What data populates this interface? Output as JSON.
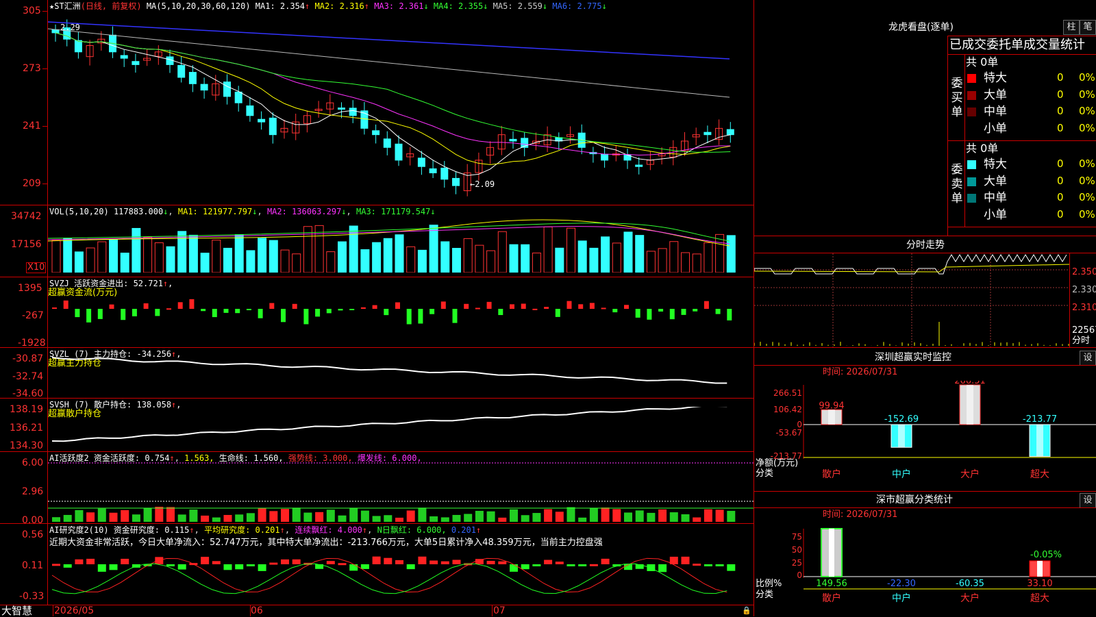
{
  "stock": {
    "name": "★ST汇洲",
    "mode": "(日线, 前复权)",
    "ma_params": "MA(5,10,20,30,60,120)",
    "ma": [
      {
        "label": "MA1:",
        "value": "2.354",
        "arrow": "↑",
        "color": "#ffffff"
      },
      {
        "label": "MA2:",
        "value": "2.316",
        "arrow": "↑",
        "color": "#ffff00"
      },
      {
        "label": "MA3:",
        "value": "2.361",
        "arrow": "↓",
        "color": "#ff33ff"
      },
      {
        "label": "MA4:",
        "value": "2.355",
        "arrow": "↓",
        "color": "#33ff33"
      },
      {
        "label": "MA5:",
        "value": "2.559",
        "arrow": "↓",
        "color": "#cccccc"
      },
      {
        "label": "MA6:",
        "value": "2.775",
        "arrow": "↓",
        "color": "#3366ff"
      }
    ],
    "arrow_colors": {
      "up": "#ff3333",
      "down": "#33ff33"
    }
  },
  "price_axis": {
    "labels": [
      "305",
      "273",
      "241",
      "209"
    ],
    "high_mark": "2.29",
    "low_mark": "←2.09"
  },
  "vol": {
    "params": "VOL(5,10,20)",
    "value": "117883.000",
    "value_arrow": "↓",
    "ma1": "MA1: 121977.797",
    "ma1_arrow": "↓",
    "ma2": "MA2: 136063.297",
    "ma2_arrow": "↓",
    "ma3": "MA3: 171179.547",
    "ma3_arrow": "↓",
    "axis": [
      "34742",
      "17156"
    ],
    "unit": "X10"
  },
  "svzj": {
    "title": "SVZJ  活跃资金进出: 52.721",
    "arrow": "↑",
    "sub": "超赢资金流(万元)",
    "axis": [
      "1395",
      "-267",
      "-1928"
    ]
  },
  "svzl": {
    "title": "SVZL (7) 主力持仓: -34.256",
    "arrow": "↑",
    "sub": "超赢主力持仓",
    "axis": [
      "-30.87",
      "-32.74",
      "-34.60"
    ]
  },
  "svsh": {
    "title": "SVSH (7) 散户持仓: 138.058",
    "arrow": "↑",
    "sub": "超赢散户持仓",
    "axis": [
      "138.19",
      "136.21",
      "134.30"
    ]
  },
  "ai_active": {
    "title": "AI活跃度2 资金活跃度: 0.754",
    "v2": "1.563,",
    "life": "生命线: 1.560,",
    "strong": "强势线: 3.000,",
    "burst": "爆发线: 6.000,",
    "axis": [
      "6.00",
      "2.96",
      "0.00"
    ]
  },
  "ai_research": {
    "title": "AI研究度2(10) 资金研究度: 0.115",
    "avg": "平均研究度: 0.201",
    "cont": "连续飘红: 4.000",
    "nday": "N日飘红: 6.000,",
    "last": "0.201",
    "axis": [
      "0.56",
      "0.11",
      "-0.33"
    ],
    "comment": "近期大资金非常活跃，今日大单净流入：52.747万元，其中特大单净流出：-213.766万元，大单5日累计净入48.359万元，当前主力控盘强"
  },
  "date_axis": {
    "brand": "大智慧",
    "labels": [
      "2026/05",
      "06",
      "07"
    ]
  },
  "dragon": {
    "title": "龙虎看盘(逐单)",
    "btn1": "柱",
    "btn2": "笔",
    "header": "已成交委托单成交量统计",
    "buy_total": "共 0单",
    "buy_label": "委买单",
    "sell_total": "共 0单",
    "sell_label": "委卖单",
    "buy_rows": [
      {
        "name": "特大",
        "count": "0",
        "pct": "0%",
        "color": "#ff0000"
      },
      {
        "name": "大单",
        "count": "0",
        "pct": "0%",
        "color": "#990000"
      },
      {
        "name": "中单",
        "count": "0",
        "pct": "0%",
        "color": "#660000"
      },
      {
        "name": "小单",
        "count": "0",
        "pct": "0%",
        "color": ""
      }
    ],
    "sell_rows": [
      {
        "name": "特大",
        "count": "0",
        "pct": "0%",
        "color": "#33ffff"
      },
      {
        "name": "大单",
        "count": "0",
        "pct": "0%",
        "color": "#009999"
      },
      {
        "name": "中单",
        "count": "0",
        "pct": "0%",
        "color": "#007777"
      },
      {
        "name": "小单",
        "count": "0",
        "pct": "0%",
        "color": ""
      }
    ]
  },
  "intraday": {
    "title": "分时走势",
    "axis": [
      "2.350",
      "2.330",
      "2.310",
      "22567",
      "分时"
    ]
  },
  "sz_monitor": {
    "title": "深圳超赢实时监控",
    "btn": "设",
    "time": "时间: 2026/07/31",
    "axis": [
      "266.51",
      "106.42",
      "0",
      "-53.67",
      "-213.77"
    ],
    "unit": "净额(万元)",
    "cat_label": "分类",
    "values": [
      {
        "cat": "散户",
        "value": "99.94"
      },
      {
        "cat": "中户",
        "value": "-152.69"
      },
      {
        "cat": "大户",
        "value": "266.51"
      },
      {
        "cat": "超大",
        "value": "-213.77"
      }
    ]
  },
  "sz_class": {
    "title": "深市超赢分类统计",
    "btn": "设",
    "time": "时间: 2026/07/31",
    "axis": [
      "75",
      "50",
      "25",
      "0"
    ],
    "unit": "比例%",
    "cat_label": "分类",
    "pct_label": "-0.05%",
    "values": [
      {
        "cat": "散户",
        "value": "149.56"
      },
      {
        "cat": "中户",
        "value": "-22.30"
      },
      {
        "cat": "大户",
        "value": "-60.35"
      },
      {
        "cat": "超大",
        "value": "33.10"
      }
    ]
  }
}
